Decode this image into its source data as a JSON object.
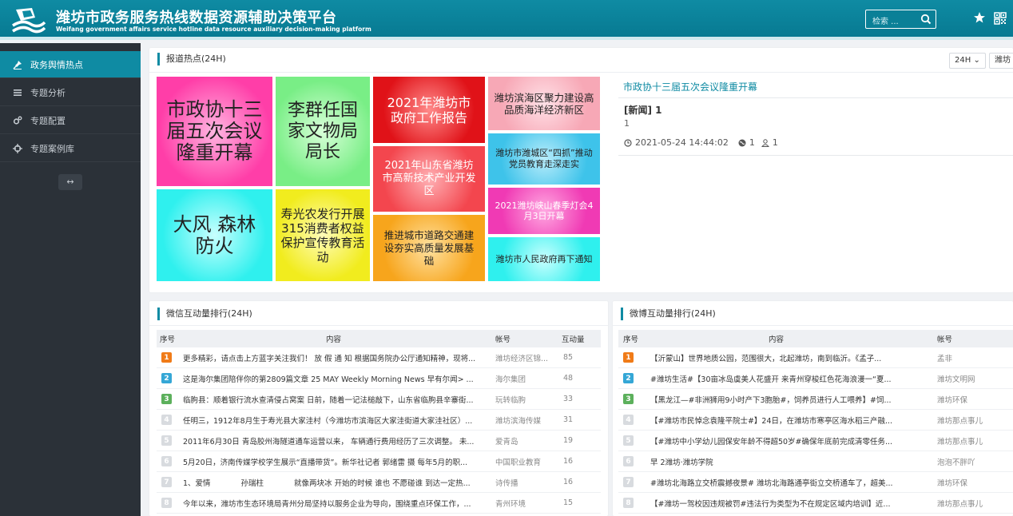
{
  "header": {
    "title_cn": "潍坊市政务服务热线数据资源辅助决策平台",
    "title_en": "Weifang government affairs service hotline data resource auxiliary decision-making platform",
    "search_placeholder": "检索 ...",
    "icons": [
      "logo-icon",
      "search-icon",
      "star-icon",
      "qrcode-icon"
    ]
  },
  "sidebar": {
    "items": [
      {
        "label": "政务舆情热点",
        "icon": "pin-icon",
        "active": true
      },
      {
        "label": "专题分析",
        "icon": "list-icon",
        "active": false
      },
      {
        "label": "专题配置",
        "icon": "gears-icon",
        "active": false
      },
      {
        "label": "专题案例库",
        "icon": "crosshair-icon",
        "active": false
      }
    ],
    "collapse_symbol": "↔"
  },
  "hotspot": {
    "title": "报道热点(24H)",
    "range_select": "24H",
    "region_select": "潍坊",
    "tiles": [
      {
        "text": "市政协十三届五次会议隆重开幕",
        "color": "#ff3ea8"
      },
      {
        "text": "李群任国家文物局局长",
        "color": "#7ff28a"
      },
      {
        "text": "2021年潍坊市政府工作报告",
        "color": "#e8181e"
      },
      {
        "text": "潍坊滨海区聚力建设高品质海洋经济新区",
        "color": "#f7a8b6"
      },
      {
        "text": "潍坊市潍城区“四抓”推动党员教育走深走实",
        "color": "#3ec3ea"
      },
      {
        "text": "2021年山东省潍坊市高新技术产业开发区",
        "color": "#f3464e"
      },
      {
        "text": "大风 森林防火",
        "color": "#2ff0ee"
      },
      {
        "text": "寿光农发行开展315消费者权益保护宣传教育活动",
        "color": "#f3ef2a"
      },
      {
        "text": "推进城市道路交通建设夯实高质量发展基础",
        "color": "#f7a51c"
      },
      {
        "text": "2021潍坊峡山春季灯会4月3日开幕",
        "color": "#f03ab4"
      },
      {
        "text": "潍坊市人民政府再下通知",
        "color": "#2ff0ee"
      }
    ],
    "detail": {
      "title": "市政协十三届五次会议隆重开幕",
      "tag_line": "[新闻] 1",
      "body": "1",
      "time": "2021-05-24 14:44:02",
      "globe_count": "1",
      "user_count": "1"
    }
  },
  "wechat": {
    "title": "微信互动量排行(24H)",
    "columns": [
      "序号",
      "内容",
      "帐号",
      "互动量"
    ],
    "rows": [
      {
        "rank": "1",
        "content": "更多精彩，请点击上方蓝字关注我们！ 放 假 通 知 根据国务院办公厅通知精神，现将...",
        "account": "潍坊经济区锦...",
        "value": "85"
      },
      {
        "rank": "2",
        "content": "这是海尔集团陪伴你的第2809篇文章 25 MAY Weekly Morning News 早有尔闻> ...",
        "account": "海尔集团",
        "value": "48"
      },
      {
        "rank": "3",
        "content": "临朐县：顺着银行流水查清侵占窝案 日前，随着一记法槌敲下，山东省临朐县辛寨街...",
        "account": "玩转临朐",
        "value": "33"
      },
      {
        "rank": "4",
        "content": "任明三，1912年8月生于寿光县大家洼村（今潍坊市滨海区大家洼街道大家洼社区）...",
        "account": "潍坊滨海传媒",
        "value": "31"
      },
      {
        "rank": "5",
        "content": "2011年6月30日 青岛胶州海隧道通车运营以来， 车辆通行费用经历了三次调整。 未...",
        "account": "爱青岛",
        "value": "19"
      },
      {
        "rank": "6",
        "content": "5月20日，济南传媒学校学生展示“直播带货”。新华社记者 郭绪雷 摄 每年5月的职...",
        "account": "中国职业教育",
        "value": "16"
      },
      {
        "rank": "7",
        "content": "1、爱情　　　　孙瑞柱　　　　就像两块冰 开始的时候 谁也 不愿碰谁 到达一定热...",
        "account": "诗传播",
        "value": "16"
      },
      {
        "rank": "8",
        "content": "今年以来，潍坊市生态环境局青州分局坚持以服务企业为导向，围绕重点环保工作，...",
        "account": "青州环境",
        "value": "15"
      }
    ]
  },
  "weibo": {
    "title": "微博互动量排行(24H)",
    "columns": [
      "序号",
      "内容",
      "帐号"
    ],
    "rows": [
      {
        "rank": "1",
        "content": "【沂蒙山】世界地质公园，范围很大，北起潍坊，南到临沂。《孟子...",
        "account": "孟非"
      },
      {
        "rank": "2",
        "content": "#潍坊生活#【30亩冰岛虞美人花盛开 来青州穿梭红色花海浪漫一“夏...",
        "account": "潍坊文明网"
      },
      {
        "rank": "3",
        "content": "【黑龙江—#非洲狮用9小时产下3胞胎#，饲养员进行人工喂养】#饲...",
        "account": "潍坊环保"
      },
      {
        "rank": "4",
        "content": "【#潍坊市民悼念袁隆平院士#】24日，在潍坊市寒亭区海水稻三产融...",
        "account": "潍坊那点事儿"
      },
      {
        "rank": "5",
        "content": "【#潍坊中小学幼儿园保安年龄不得超50岁#确保年底前完成清零任务...",
        "account": "潍坊那点事儿"
      },
      {
        "rank": "6",
        "content": "早 2潍坊·潍坊学院",
        "account": "泡泡不胖吖"
      },
      {
        "rank": "7",
        "content": "#潍坊北海路立交桥震撼夜景# 潍坊北海路通亭街立交桥通车了，超美...",
        "account": "潍坊环保"
      },
      {
        "rank": "8",
        "content": "【#潍坊一驾校因违规被罚#违法行为类型为不在规定区域内培训】近...",
        "account": "潍坊那点事儿"
      }
    ]
  },
  "rank_colors": {
    "1": "#f07b18",
    "2": "#35a7d6",
    "3": "#5cb05c",
    "other": "#d8dbdf"
  }
}
